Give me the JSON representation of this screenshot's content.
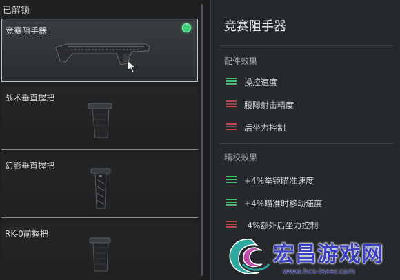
{
  "unlocked_section": {
    "label": "已解锁"
  },
  "items": [
    {
      "name": "竞赛阻手器",
      "selected": true,
      "equipped": true
    },
    {
      "name": "战术垂直握把",
      "selected": false,
      "equipped": false
    },
    {
      "name": "幻影垂直握把",
      "selected": false,
      "equipped": false
    },
    {
      "name": "RK-0前握把",
      "selected": false,
      "equipped": false
    }
  ],
  "detail": {
    "title": "竞赛阻手器",
    "attachment_effects": {
      "title": "配件效果",
      "stats": [
        {
          "label": "操控速度",
          "color": "#3fbf6e"
        },
        {
          "label": "腰际射击精度",
          "color": "#c0454a"
        },
        {
          "label": "后坐力控制",
          "color": "#c0454a"
        }
      ]
    },
    "tuning_effects": {
      "title": "精校效果",
      "stats": [
        {
          "label": "+4%举镜瞄准速度",
          "color": "#3fbf6e"
        },
        {
          "label": "+4%瞄准时移动速度",
          "color": "#3fbf6e"
        },
        {
          "label": "-4%额外后坐力控制",
          "color": "#c0454a"
        }
      ]
    }
  },
  "watermark": {
    "text": "宏昌游戏网",
    "url": "www.hcs-laser.com"
  },
  "colors": {
    "equipped": "#3fd27a",
    "positive": "#3fbf6e",
    "negative": "#c0454a"
  }
}
